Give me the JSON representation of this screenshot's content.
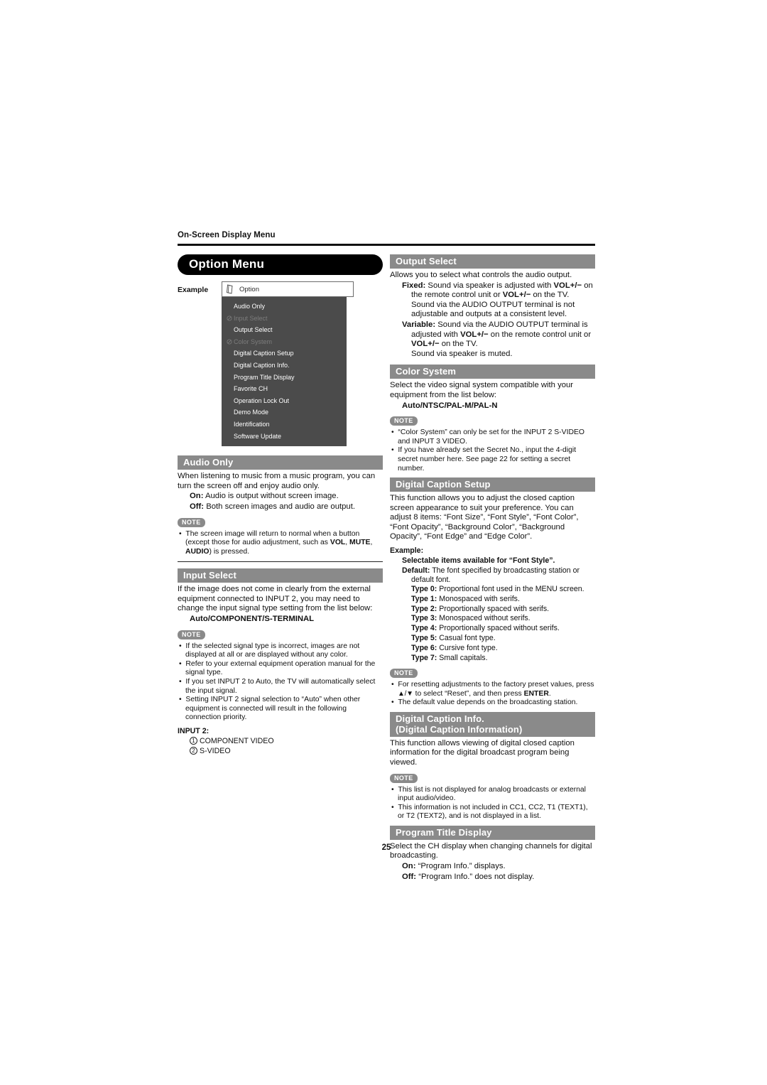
{
  "running_head": "On-Screen Display Menu",
  "page_number": "25",
  "title_banner": "Option Menu",
  "example": {
    "label": "Example",
    "osd_title": "Option",
    "title_icon": "card-icon",
    "disabled_icon": "prohibited-icon",
    "items": [
      {
        "label": "Audio Only",
        "disabled": false
      },
      {
        "label": "Input Select",
        "disabled": true
      },
      {
        "label": "Output Select",
        "disabled": false
      },
      {
        "label": "Color System",
        "disabled": true
      },
      {
        "label": "Digital Caption Setup",
        "disabled": false
      },
      {
        "label": "Digital Caption Info.",
        "disabled": false
      },
      {
        "label": "Program Title Display",
        "disabled": false
      },
      {
        "label": "Favorite CH",
        "disabled": false
      },
      {
        "label": "Operation Lock Out",
        "disabled": false
      },
      {
        "label": "Demo Mode",
        "disabled": false
      },
      {
        "label": "Identification",
        "disabled": false
      },
      {
        "label": "Software Update",
        "disabled": false
      }
    ]
  },
  "note_badge": "NOTE",
  "audio_only": {
    "heading": "Audio Only",
    "body": "When listening to music from a music program, you can turn the screen off and enjoy audio only.",
    "on_label": "On:",
    "on_text": " Audio is output without screen image.",
    "off_label": "Off:",
    "off_text": " Both screen images and audio are output.",
    "note1_a": "The screen image will return to normal when a button (except those for audio adjustment, such as ",
    "note1_vol": "VOL",
    "note1_sep1": ", ",
    "note1_mute": "MUTE",
    "note1_sep2": ", ",
    "note1_audio": "AUDIO",
    "note1_b": ") is pressed."
  },
  "input_select": {
    "heading": "Input Select",
    "body": "If the image does not come in clearly from the external equipment connected to INPUT 2, you may need to change the input signal type setting from the list below:",
    "options": "Auto/COMPONENT/S-TERMINAL",
    "notes": [
      "If the selected signal type is incorrect, images are not displayed at all or are displayed without any color.",
      "Refer to your external equipment operation manual for the signal type.",
      "If you set INPUT 2 to Auto, the TV will automatically select the input signal.",
      "Setting INPUT 2 signal selection to “Auto” when other equipment is connected will result in the following connection priority."
    ],
    "input2_label": "INPUT 2:",
    "priority": [
      {
        "num": "1",
        "label": "COMPONENT VIDEO"
      },
      {
        "num": "2",
        "label": "S-VIDEO"
      }
    ]
  },
  "output_select": {
    "heading": "Output Select",
    "body": "Allows you to select what controls the audio output.",
    "fixed_label": "Fixed:",
    "fixed_1a": " Sound via speaker is adjusted with ",
    "fixed_vol1": "VOL",
    "fixed_pm1": "+/−",
    "fixed_1b": " on the remote control unit or ",
    "fixed_vol2": "VOL",
    "fixed_pm2": "+/−",
    "fixed_1c": " on the TV.",
    "fixed_2": "Sound via the AUDIO OUTPUT terminal is not adjustable and outputs at a consistent level.",
    "variable_label": "Variable:",
    "variable_1a": " Sound via the AUDIO OUTPUT terminal is adjusted with ",
    "variable_vol1": "VOL",
    "variable_pm1": "+/−",
    "variable_1b": " on the remote control unit or ",
    "variable_vol2": "VOL",
    "variable_pm2": "+/−",
    "variable_1c": " on the TV.",
    "variable_2": "Sound via speaker is muted."
  },
  "color_system": {
    "heading": "Color System",
    "body": "Select the video signal system compatible with your equipment from the list below:",
    "options": "Auto/NTSC/PAL-M/PAL-N",
    "notes": [
      "“Color System” can only be set for the INPUT 2 S-VIDEO and INPUT 3 VIDEO.",
      "If you have already set the Secret No., input the 4-digit secret number here. See page 22 for setting a secret number."
    ]
  },
  "digital_caption_setup": {
    "heading": "Digital Caption Setup",
    "body": "This function allows you to adjust the closed caption screen appearance to suit your preference. You can adjust 8 items: “Font Size”, “Font Style”, “Font Color”, “Font Opacity”, “Background Color”, “Background Opacity”, “Font Edge” and “Edge Color”.",
    "example_label": "Example:",
    "example_sub": "Selectable items available for “Font Style”.",
    "styles": [
      {
        "name": "Default:",
        "desc": " The font specified by broadcasting station or default font."
      },
      {
        "name": "Type 0:",
        "desc": " Proportional font used in the MENU screen."
      },
      {
        "name": "Type 1:",
        "desc": " Monospaced with serifs."
      },
      {
        "name": "Type 2:",
        "desc": " Proportionally spaced with serifs."
      },
      {
        "name": "Type 3:",
        "desc": " Monospaced without serifs."
      },
      {
        "name": "Type 4:",
        "desc": " Proportionally spaced without serifs."
      },
      {
        "name": "Type 5:",
        "desc": " Casual font type."
      },
      {
        "name": "Type 6:",
        "desc": " Cursive font type."
      },
      {
        "name": "Type 7:",
        "desc": " Small capitals."
      }
    ],
    "note1_a": "For resetting adjustments to the factory preset values, press ",
    "note1_arrows": "▲/▼",
    "note1_b": " to select “Reset”, and then press ",
    "note1_enter": "ENTER",
    "note1_c": ".",
    "note2": "The default value depends on the broadcasting station."
  },
  "digital_caption_info": {
    "heading_line1": "Digital Caption Info.",
    "heading_line2": "(Digital Caption Information)",
    "body": "This function allows viewing of digital closed caption information for the digital broadcast program being viewed.",
    "notes": [
      "This list is not displayed for analog broadcasts or external input audio/video.",
      "This information is not included in CC1, CC2, T1 (TEXT1), or T2 (TEXT2), and is not displayed in a list."
    ]
  },
  "program_title_display": {
    "heading": "Program Title Display",
    "body": "Select the CH display when changing channels for digital broadcasting.",
    "on_label": "On:",
    "on_text": " “Program Info.” displays.",
    "off_label": "Off:",
    "off_text": " “Program Info.” does not display."
  }
}
